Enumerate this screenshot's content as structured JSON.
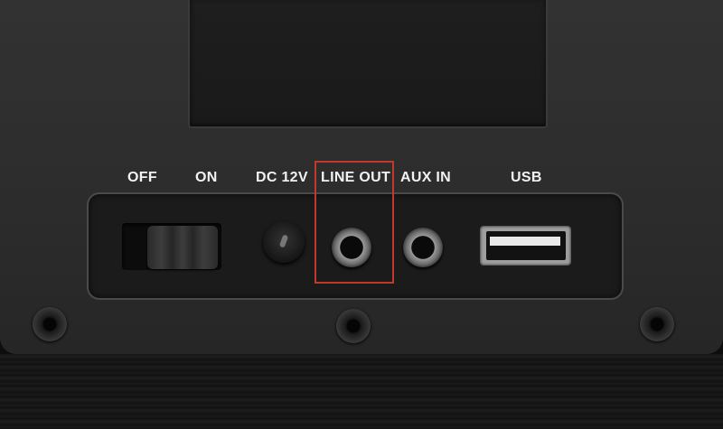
{
  "panel": {
    "labels": {
      "off": "OFF",
      "on": "ON",
      "dc": "DC 12V",
      "line_out": "LINE OUT",
      "aux_in": "AUX IN",
      "usb": "USB"
    }
  },
  "colors": {
    "device_body": "#2c2c2c",
    "plate": "#1b1b1b",
    "highlight": "#c0392b",
    "label_text": "#f2f2f2"
  },
  "highlighted_port": "line_out"
}
